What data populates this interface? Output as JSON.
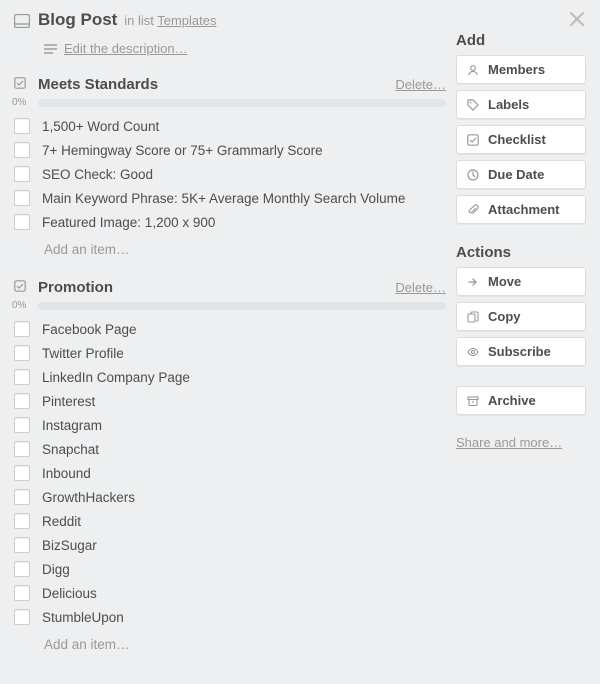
{
  "card": {
    "title": "Blog Post",
    "in_list_prefix": "in list",
    "list_name": "Templates",
    "edit_description": "Edit the description…"
  },
  "checklists": [
    {
      "title": "Meets Standards",
      "delete": "Delete…",
      "percent": "0%",
      "items": [
        "1,500+ Word Count",
        "7+ Hemingway Score or 75+ Grammarly Score",
        "SEO Check: Good",
        "Main Keyword Phrase: 5K+ Average Monthly Search Volume",
        "Featured Image: 1,200 x 900"
      ],
      "add": "Add an item…"
    },
    {
      "title": "Promotion",
      "delete": "Delete…",
      "percent": "0%",
      "items": [
        "Facebook Page",
        "Twitter Profile",
        "LinkedIn Company Page",
        "Pinterest",
        "Instagram",
        "Snapchat",
        "Inbound",
        "GrowthHackers",
        "Reddit",
        "BizSugar",
        "Digg",
        "Delicious",
        "StumbleUpon"
      ],
      "add": "Add an item…"
    }
  ],
  "sidebar": {
    "add_heading": "Add",
    "add_buttons": [
      {
        "icon": "members-icon",
        "label": "Members"
      },
      {
        "icon": "labels-icon",
        "label": "Labels"
      },
      {
        "icon": "checklist-icon",
        "label": "Checklist"
      },
      {
        "icon": "duedate-icon",
        "label": "Due Date"
      },
      {
        "icon": "attachment-icon",
        "label": "Attachment"
      }
    ],
    "actions_heading": "Actions",
    "action_buttons": [
      {
        "icon": "move-icon",
        "label": "Move"
      },
      {
        "icon": "copy-icon",
        "label": "Copy"
      },
      {
        "icon": "subscribe-icon",
        "label": "Subscribe"
      }
    ],
    "archive_button": {
      "icon": "archive-icon",
      "label": "Archive"
    },
    "share": "Share and more…"
  },
  "icons": {
    "card": "card-icon",
    "description": "description-icon",
    "checklist": "checklist-icon",
    "close": "close-icon"
  }
}
